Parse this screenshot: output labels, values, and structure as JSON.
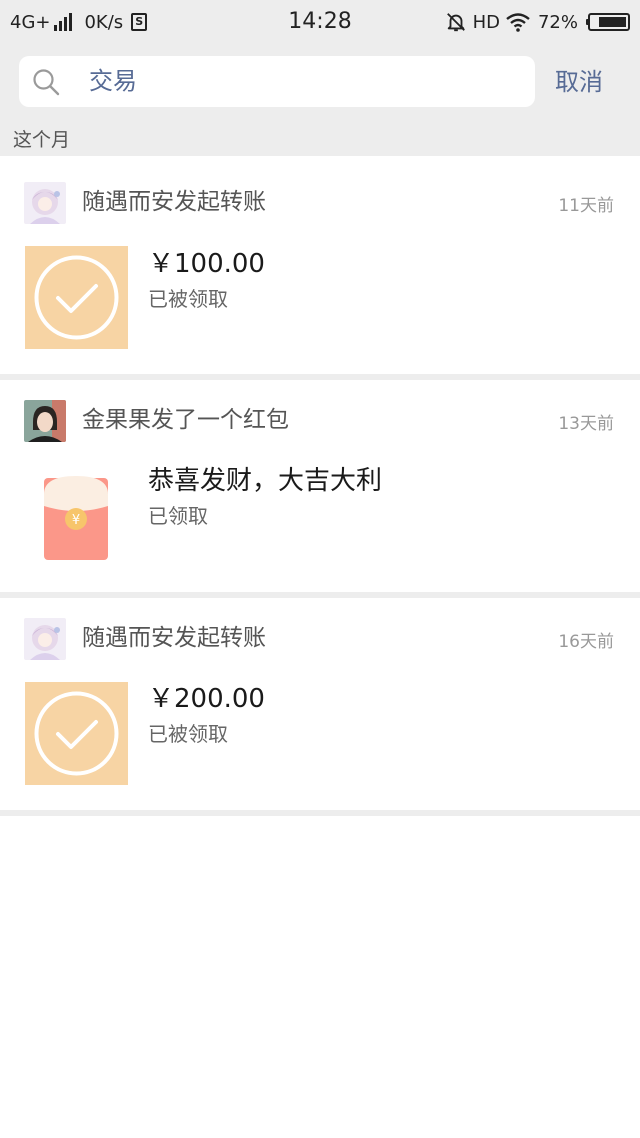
{
  "status_bar": {
    "network": "4G+",
    "speed": "0K/s",
    "sim": "S",
    "time": "14:28",
    "hd": "HD",
    "battery": "72%",
    "battery_level": 0.72
  },
  "search": {
    "query": "交易",
    "cancel_label": "取消"
  },
  "section_title": "这个月",
  "records": [
    {
      "type": "transfer",
      "title": "随遇而安发起转账",
      "time": "11天前",
      "main": "￥100.00",
      "sub": "已被领取"
    },
    {
      "type": "red-packet",
      "title": "金果果发了一个红包",
      "time": "13天前",
      "main": "恭喜发财，大吉大利",
      "sub": "已领取"
    },
    {
      "type": "transfer",
      "title": "随遇而安发起转账",
      "time": "16天前",
      "main": "￥200.00",
      "sub": "已被领取"
    }
  ],
  "colors": {
    "link": "#576b95",
    "transfer_bg": "#f7d4a4",
    "red_packet": "#fb9789",
    "red_packet_top": "#fbeee2",
    "coin": "#f7c56b",
    "page_bg": "#ededed"
  },
  "icons": {
    "search": "search-icon",
    "transfer": "check-circle-icon",
    "red_packet": "red-packet-icon",
    "mute": "bell-off-icon",
    "wifi": "wifi-icon",
    "battery": "battery-icon"
  }
}
